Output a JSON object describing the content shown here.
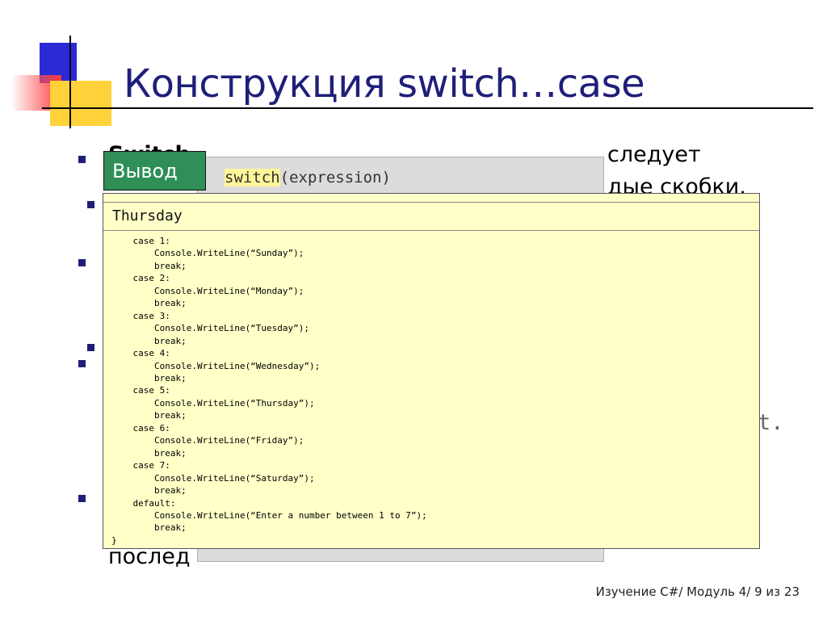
{
  "slide": {
    "title": "Конструкция switch…case",
    "footer": "Изучение C#/ Модуль 4/ 9 из 23"
  },
  "background_text": {
    "line1_bold": "Switch",
    "line1_rest": "следует",
    "line2": "дые скобки.",
    "line3_end": "t.",
    "line4": "послед"
  },
  "gray_panel": {
    "keyword": "switch",
    "rest": "(expression)"
  },
  "output": {
    "tag_label": "Вывод",
    "result": "Thursday"
  },
  "code_lines": [
    "    case 1:",
    "        Console.WriteLine(“Sunday”);",
    "        break;",
    "    case 2:",
    "        Console.WriteLine(“Monday”);",
    "        break;",
    "    case 3:",
    "        Console.WriteLine(“Tuesday”);",
    "        break;",
    "    case 4:",
    "        Console.WriteLine(“Wednesday”);",
    "        break;",
    "    case 5:",
    "        Console.WriteLine(“Thursday”);",
    "        break;",
    "    case 6:",
    "        Console.WriteLine(“Friday”);",
    "        break;",
    "    case 7:",
    "        Console.WriteLine(“Saturday”);",
    "        break;",
    "    default:",
    "        Console.WriteLine(“Enter a number between 1 to 7”);",
    "        break;",
    "}"
  ],
  "colors": {
    "title": "#1f1f7a",
    "output_tag": "#2f8f57",
    "code_box": "#ffffc8",
    "gray_panel": "#dcdcdc"
  }
}
